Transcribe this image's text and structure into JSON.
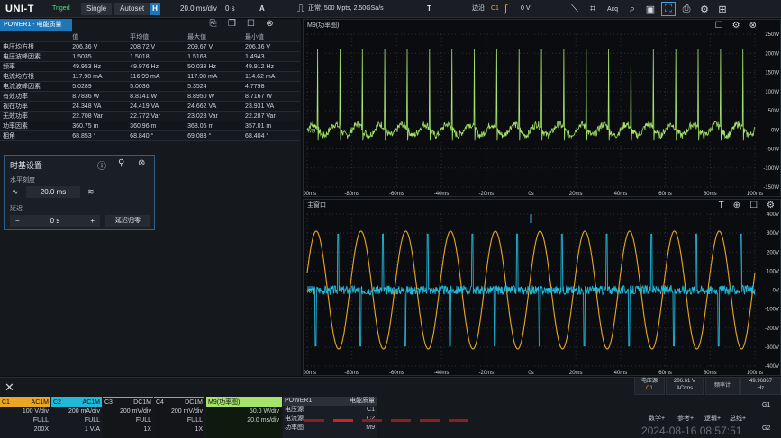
{
  "topbar": {
    "brand": "UNI-T",
    "trig_state": "Triged",
    "single": "Single",
    "autoset": "Autoset",
    "h_mark": "H",
    "timebase": "20.0 ms/div",
    "delay": "0 s",
    "auto_mode": "A",
    "acq_info": "正常, 500 Mpts, 2.50GSa/s",
    "trig_mark": "T",
    "trig_type": "边沿",
    "trig_src": "C1",
    "trig_level": "0 V",
    "acq_label": "Acq"
  },
  "power_panel": {
    "tab_label": "POWER1 - 电能质量",
    "headers": [
      "",
      "值",
      "平均值",
      "最大值",
      "最小值"
    ],
    "rows": [
      [
        "电压均方根",
        "206.36 V",
        "208.72 V",
        "209.67 V",
        "206.36 V"
      ],
      [
        "电压波峰因素",
        "1.5035",
        "1.5018",
        "1.5168",
        "1.4943"
      ],
      [
        "频率",
        "49.953 Hz",
        "49.976 Hz",
        "50.038 Hz",
        "49.912 Hz"
      ],
      [
        "电流均方根",
        "117.98 mA",
        "116.99 mA",
        "117.98 mA",
        "114.62 mA"
      ],
      [
        "电流波峰因素",
        "5.0289",
        "5.0036",
        "5.3524",
        "4.7798"
      ],
      [
        "有效功率",
        "8.7836 W",
        "8.8141 W",
        "8.8950 W",
        "8.7167 W"
      ],
      [
        "视在功率",
        "24.348 VA",
        "24.419 VA",
        "24.662 VA",
        "23.931 VA"
      ],
      [
        "无效功率",
        "22.708 Var",
        "22.772 Var",
        "23.028 Var",
        "22.287 Var"
      ],
      [
        "功率因素",
        "360.75 m",
        "360.96 m",
        "368.05 m",
        "357.01 m"
      ],
      [
        "相角",
        "68.853 °",
        "68.840 °",
        "69.083 °",
        "68.404 °"
      ]
    ]
  },
  "timebase_dialog": {
    "title": "时基设置",
    "h_scale_label": "水平刻度",
    "h_scale_value": "20.0 ms",
    "delay_label": "延迟",
    "delay_value": "0 s",
    "minus": "−",
    "plus": "+",
    "reset_label": "延迟归零"
  },
  "math_window": {
    "title": "M9(功率图)",
    "y_labels": [
      "250W",
      "200W",
      "150W",
      "100W",
      "50W",
      "0W",
      "-50W",
      "-100W",
      "-150W"
    ],
    "x_labels": [
      "-100ms",
      "-80ms",
      "-60ms",
      "-40ms",
      "-20ms",
      "0s",
      "20ms",
      "40ms",
      "60ms",
      "80ms",
      "100ms"
    ],
    "marker": "M9",
    "color": "#a6e36a"
  },
  "main_window": {
    "title": "主窗口",
    "y_labels": [
      "400V",
      "300V",
      "200V",
      "100V",
      "0V",
      "-100V",
      "-200V",
      "-300V",
      "-400V"
    ],
    "x_labels": [
      "-100ms",
      "-80ms",
      "-60ms",
      "-40ms",
      "-20ms",
      "0s",
      "20ms",
      "40ms",
      "60ms",
      "80ms",
      "100ms"
    ],
    "marker": "C1",
    "ch1_color": "#e8a826",
    "ch2_color": "#23b7d8"
  },
  "channels": [
    {
      "id": "C1",
      "coupling": "AC1M",
      "scale": "100 V/div",
      "bw": "FULL",
      "probe": "200X",
      "color": "#e8a826"
    },
    {
      "id": "C2",
      "coupling": "AC1M",
      "scale": "200 mA/div",
      "bw": "FULL",
      "probe": "1 V/A",
      "color": "#23b7d8"
    },
    {
      "id": "C3",
      "coupling": "DC1M",
      "scale": "200 mV/div",
      "bw": "FULL",
      "probe": "1X",
      "color": "#9aa0a8"
    },
    {
      "id": "C4",
      "coupling": "DC1M",
      "scale": "200 mV/div",
      "bw": "FULL",
      "probe": "1X",
      "color": "#9aa0a8"
    }
  ],
  "math_box": {
    "title": "M9(功率图)",
    "scale": "50.0 W/div",
    "time": "20.0 ms/div"
  },
  "power_box": {
    "title": "POWER1",
    "mode": "电能质量",
    "src_v_label": "电压源",
    "src_v": "C1",
    "src_i_label": "电流源",
    "src_i": "C2",
    "out_label": "功率图",
    "out": "M9"
  },
  "readouts": [
    {
      "label": "电压源",
      "sub": "C1",
      "value": "206.61 V",
      "unit": "ACrms"
    },
    {
      "label": "频率计",
      "sub": "",
      "value": "49.96867",
      "unit": "Hz"
    }
  ],
  "menu": {
    "math": "数学+",
    "ref": "参考+",
    "bus": "逻辑+",
    "bus2": "总线+",
    "g1": "G1",
    "g2": "G2"
  },
  "clock": "2024-08-16 08:57:51"
}
